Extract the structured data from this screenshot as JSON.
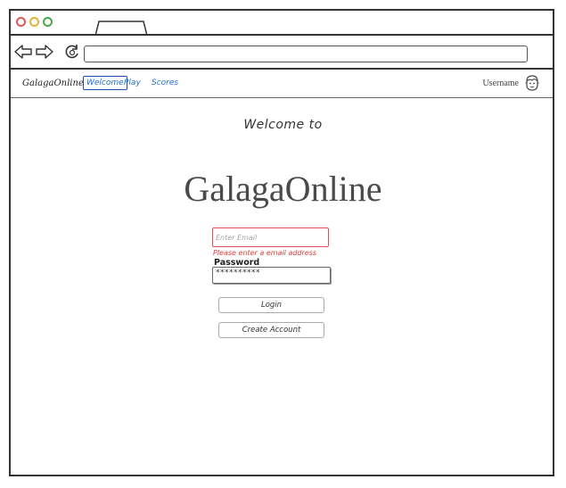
{
  "browser": {
    "window_controls": [
      "close-dot",
      "minimize-dot",
      "maximize-dot"
    ],
    "url": ""
  },
  "nav": {
    "brand": "GalagaOnline",
    "links": [
      {
        "label": "Welcome",
        "active": true
      },
      {
        "label": "Play",
        "active": false
      },
      {
        "label": "Scores",
        "active": false
      }
    ],
    "username": "Username"
  },
  "main": {
    "welcome_text": "Welcome to",
    "title": "GalagaOnline",
    "email_placeholder": "Enter Email",
    "email_error": "Please enter a email address",
    "password_label": "Password",
    "password_value": "**********",
    "login_label": "Login",
    "create_account_label": "Create Account"
  },
  "colors": {
    "link": "#1f6fd1",
    "error": "#d94040",
    "frame": "#333333"
  }
}
